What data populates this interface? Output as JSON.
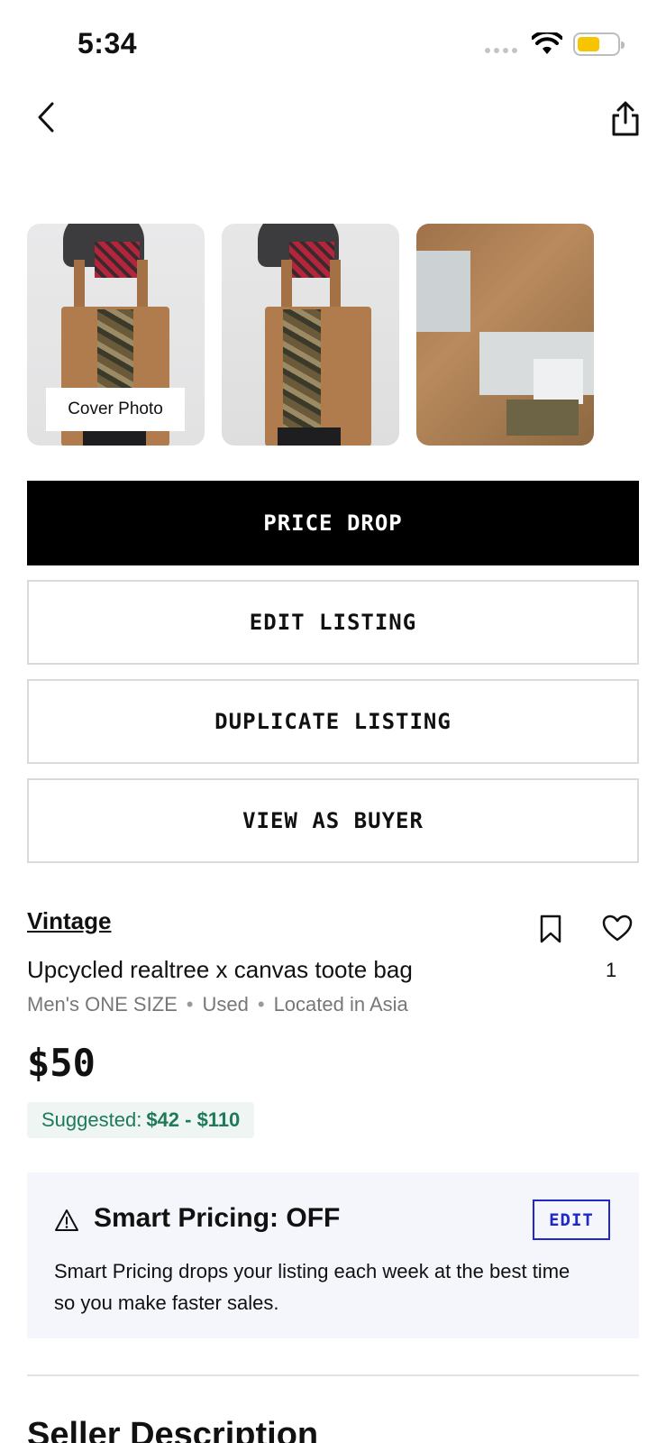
{
  "status_bar": {
    "time": "5:34"
  },
  "photos": {
    "cover_label": "Cover Photo"
  },
  "actions": {
    "price_drop": "PRICE DROP",
    "edit_listing": "EDIT LISTING",
    "duplicate_listing": "DUPLICATE LISTING",
    "view_as_buyer": "VIEW AS BUYER"
  },
  "listing": {
    "designer": "Vintage",
    "title": "Upcycled realtree x canvas toote bag",
    "like_count": "1",
    "meta": {
      "size": "Men's ONE SIZE",
      "condition": "Used",
      "location": "Located in Asia"
    },
    "price": "$50",
    "suggested_label": "Suggested:",
    "suggested_range": "$42 - $110"
  },
  "smart_pricing": {
    "title": "Smart Pricing: OFF",
    "edit_label": "EDIT",
    "description": "Smart Pricing drops your listing each week at the best time so you make faster sales."
  },
  "seller_description": {
    "heading": "Seller Description"
  },
  "colors": {
    "primary": "#000000",
    "accent_blue": "#1f28c9",
    "suggested_green": "#1e7a58",
    "battery": "#f7c500"
  },
  "icons": [
    "back-icon",
    "share-icon",
    "wifi-icon",
    "battery-icon",
    "bookmark-icon",
    "heart-icon",
    "warning-icon"
  ]
}
